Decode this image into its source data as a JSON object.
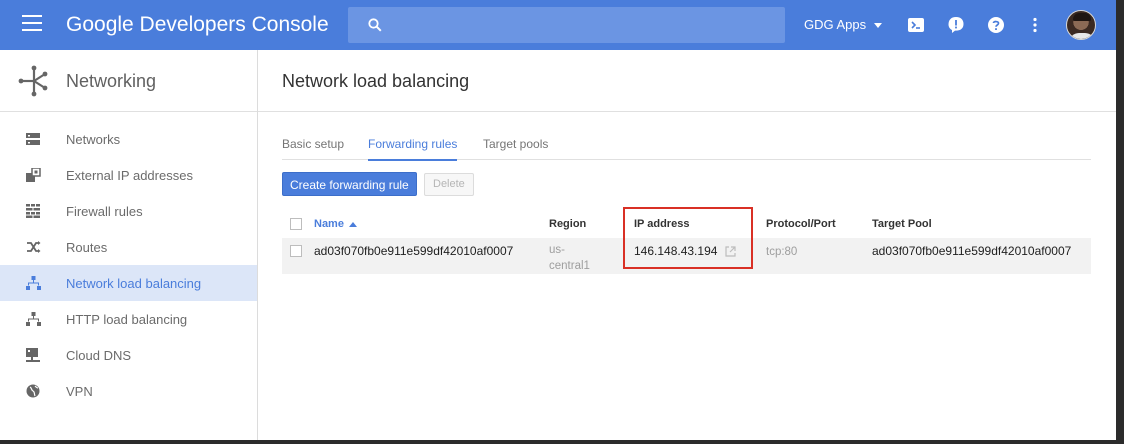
{
  "topbar": {
    "app_title": "Google Developers Console",
    "search_placeholder": "",
    "project": "GDG Apps",
    "brand_color": "#4a7ddb"
  },
  "sidebar": {
    "section_title": "Networking",
    "items": [
      {
        "label": "Networks",
        "icon": "network-icon",
        "active": false
      },
      {
        "label": "External IP addresses",
        "icon": "ip-address-icon",
        "active": false
      },
      {
        "label": "Firewall rules",
        "icon": "firewall-icon",
        "active": false
      },
      {
        "label": "Routes",
        "icon": "routes-icon",
        "active": false
      },
      {
        "label": "Network load balancing",
        "icon": "load-balancer-icon",
        "active": true
      },
      {
        "label": "HTTP load balancing",
        "icon": "load-balancer-icon",
        "active": false
      },
      {
        "label": "Cloud DNS",
        "icon": "dns-icon",
        "active": false
      },
      {
        "label": "VPN",
        "icon": "globe-icon",
        "active": false
      }
    ]
  },
  "main": {
    "page_title": "Network load balancing",
    "tabs": [
      {
        "label": "Basic setup",
        "active": false
      },
      {
        "label": "Forwarding rules",
        "active": true
      },
      {
        "label": "Target pools",
        "active": false
      }
    ],
    "create_button": "Create forwarding rule",
    "delete_button": "Delete",
    "table": {
      "headers": {
        "name": "Name",
        "region": "Region",
        "ip": "IP address",
        "protocol": "Protocol/Port",
        "target": "Target Pool"
      },
      "rows": [
        {
          "name": "ad03f070fb0e911e599df42010af0007",
          "region": "us-central1",
          "ip": "146.148.43.194",
          "protocol": "tcp:80",
          "target": "ad03f070fb0e911e599df42010af0007"
        }
      ]
    },
    "highlight_color": "#d93025"
  }
}
